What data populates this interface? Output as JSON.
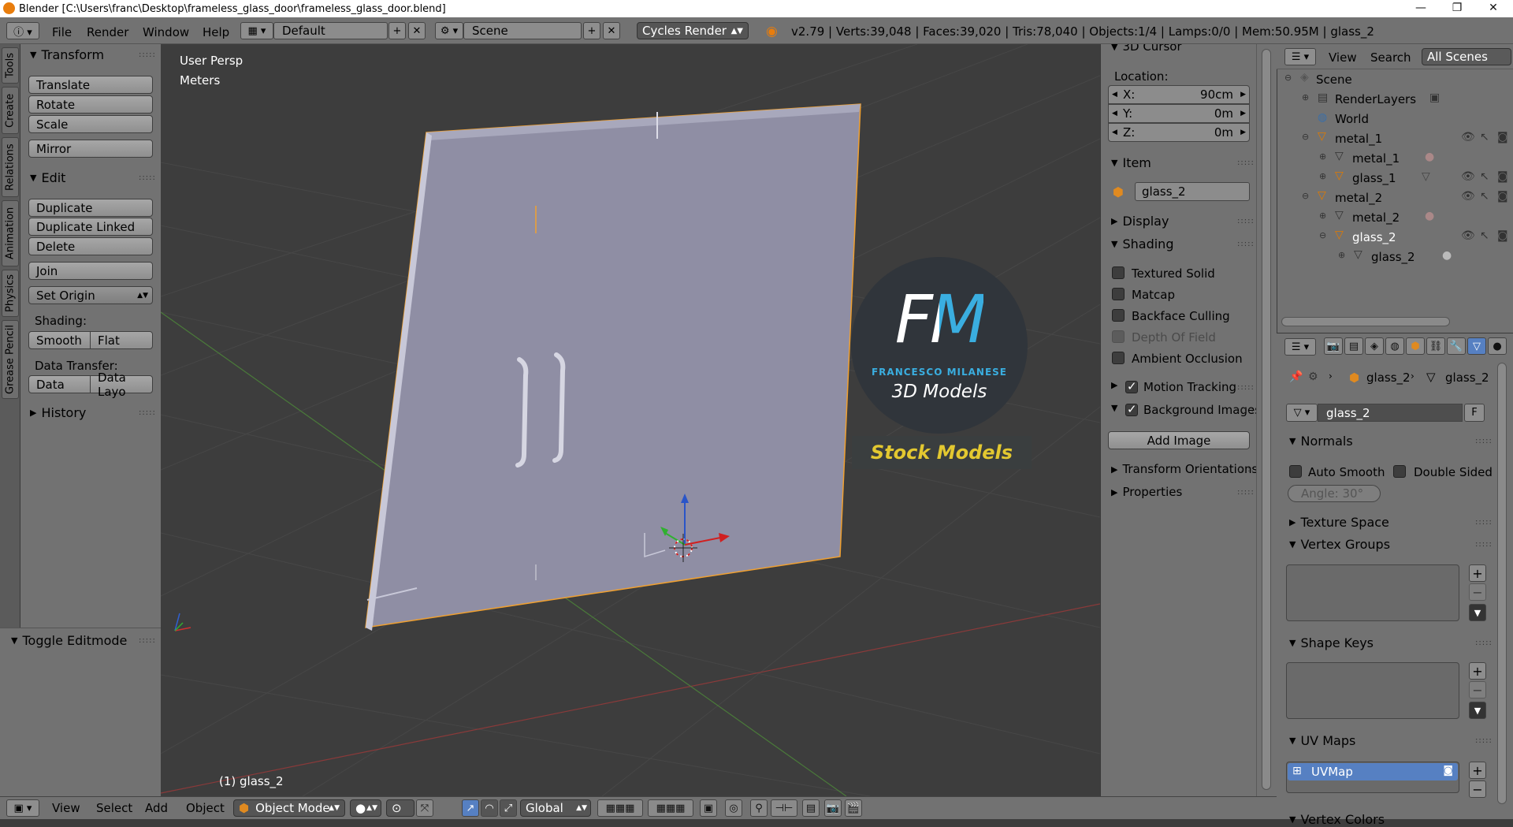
{
  "title_bar": {
    "title": "Blender [C:\\Users\\franc\\Desktop\\frameless_glass_door\\frameless_glass_door.blend]",
    "minimize": "—",
    "maximize": "❐",
    "close": "✕"
  },
  "header": {
    "menus": [
      "File",
      "Render",
      "Window",
      "Help"
    ],
    "layout": "Default",
    "scene": "Scene",
    "engine": "Cycles Render",
    "stats": "v2.79 | Verts:39,048 | Faces:39,020 | Tris:78,040 | Objects:1/4 | Lamps:0/0 | Mem:50.95M | glass_2"
  },
  "tool_tabs": [
    "Tools",
    "Create",
    "Relations",
    "Animation",
    "Physics",
    "Grease Pencil"
  ],
  "tool_shelf": {
    "transform_header": "Transform",
    "translate": "Translate",
    "rotate": "Rotate",
    "scale": "Scale",
    "mirror": "Mirror",
    "edit_header": "Edit",
    "duplicate": "Duplicate",
    "duplicate_linked": "Duplicate Linked",
    "delete": "Delete",
    "join": "Join",
    "set_origin": "Set Origin",
    "shading_label": "Shading:",
    "smooth": "Smooth",
    "flat": "Flat",
    "data_transfer_label": "Data Transfer:",
    "data": "Data",
    "data_layout": "Data Layo",
    "history_header": "History",
    "toggle_editmode": "Toggle Editmode"
  },
  "viewport": {
    "view_name": "User Persp",
    "units": "Meters",
    "selected": "(1) glass_2",
    "watermark_logo": "FM",
    "watermark_author": "FRANCESCO MILANESE",
    "watermark_sub": "3D Models",
    "watermark_banner": "Stock Models"
  },
  "n_panel": {
    "cursor_header": "3D Cursor",
    "location_label": "Location:",
    "x_label": "X:",
    "x_value": "90cm",
    "y_label": "Y:",
    "y_value": "0m",
    "z_label": "Z:",
    "z_value": "0m",
    "item_header": "Item",
    "item_name": "glass_2",
    "display_header": "Display",
    "shading_header": "Shading",
    "textured_solid": "Textured Solid",
    "matcap": "Matcap",
    "backface_culling": "Backface Culling",
    "depth_of_field": "Depth Of Field",
    "ambient_occlusion": "Ambient Occlusion",
    "motion_tracking": "Motion Tracking",
    "background_images": "Background Images",
    "add_image": "Add Image",
    "transform_orientations": "Transform Orientations",
    "properties": "Properties"
  },
  "outliner": {
    "view": "View",
    "search": "Search",
    "filter": "All Scenes",
    "items": {
      "scene": "Scene",
      "render_layers": "RenderLayers",
      "world": "World",
      "metal_1_obj": "metal_1",
      "metal_1_mesh": "metal_1",
      "glass_1": "glass_1",
      "metal_2_obj": "metal_2",
      "metal_2_mesh": "metal_2",
      "glass_2_obj": "glass_2",
      "glass_2_mesh": "glass_2"
    }
  },
  "properties": {
    "crumb_object": "glass_2",
    "crumb_mesh": "glass_2",
    "mesh_name": "glass_2",
    "fake_user": "F",
    "normals_header": "Normals",
    "auto_smooth": "Auto Smooth",
    "double_sided": "Double Sided",
    "angle": "Angle:   30°",
    "texture_space": "Texture Space",
    "vertex_groups": "Vertex Groups",
    "shape_keys": "Shape Keys",
    "uv_maps": "UV Maps",
    "uv_map_name": "UVMap",
    "vertex_colors": "Vertex Colors"
  },
  "bottom_bar": {
    "menus": [
      "View",
      "Select",
      "Add",
      "Object"
    ],
    "mode": "Object Mode",
    "orientation": "Global"
  },
  "colors": {
    "selection_outline": "#f0a030",
    "accent_blue": "#5680c2",
    "door_face": "#9392a8",
    "logo_blue": "#3aaee0",
    "banner_yellow": "#e3c830"
  }
}
